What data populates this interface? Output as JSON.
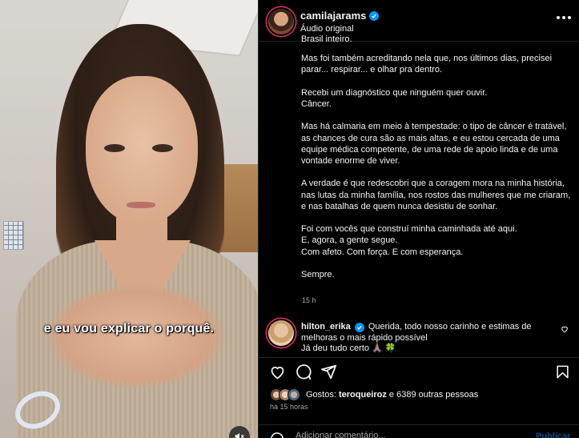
{
  "video": {
    "caption_overlay": "e eu vou explicar o porquê."
  },
  "post": {
    "username": "camilajarams",
    "audio_label": "Áudio original",
    "caption_top_partial": "Brasil inteiro.",
    "caption_paragraphs": [
      "Mas foi também acreditando nela que, nos últimos dias, precisei parar... respirar... e olhar pra dentro.",
      "Recebi um diagnóstico que ninguém quer ouvir.\nCâncer.",
      "Mas há calmaria em meio à tempestade: o tipo de câncer é tratável, as chances de cura são as mais altas, e eu estou cercada de uma equipe médica competente, de uma rede de apoio linda e de uma vontade enorme de viver.",
      "A verdade é que redescobri que a coragem mora na minha história, nas lutas da minha família, nos rostos das mulheres que me criaram, e nas batalhas de quem nunca desistiu de sonhar.",
      "Foi com vocês que construí minha caminhada até aqui.\nE, agora, a gente segue.\nCom afeto. Com força. E com esperança.",
      "Sempre."
    ],
    "caption_time": "15 h"
  },
  "comment": {
    "username": "hilton_erika",
    "text": "Querida, todo nosso carinho e estimas de melhoras o mais rápido possível",
    "text2": "Já deu tudo certo 🙏🏽 🍀"
  },
  "likes": {
    "prefix": "Gostos: ",
    "first_user": "teroqueiroz",
    "rest": " e 6389 outras pessoas"
  },
  "post_time": "há 15 horas",
  "add_comment": {
    "placeholder": "Adicionar comentário...",
    "publish_label": "Publicar"
  },
  "colors": {
    "accent": "#0095f6",
    "story_ring": "#e1306c",
    "secondary_text": "#a8a8a8"
  },
  "icons": [
    "more-icon",
    "verified-icon",
    "heart-icon",
    "comment-icon",
    "share-icon",
    "bookmark-icon",
    "emoji-icon",
    "mute-icon"
  ]
}
